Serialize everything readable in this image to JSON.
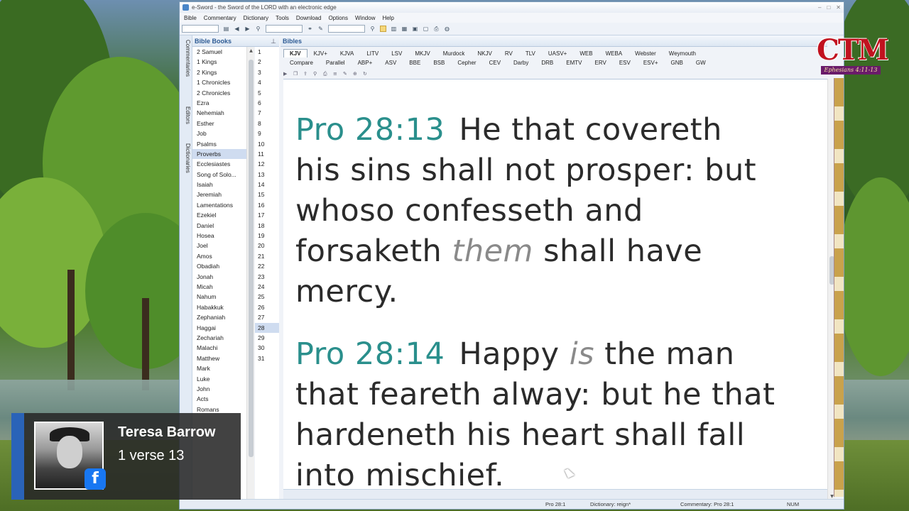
{
  "window": {
    "title": "e-Sword - the Sword of the LORD with an electronic edge",
    "menu": [
      "Bible",
      "Commentary",
      "Dictionary",
      "Tools",
      "Download",
      "Options",
      "Window",
      "Help"
    ]
  },
  "side_tabs": [
    "Commentaries",
    "Editors",
    "Dictionaries"
  ],
  "books_panel": {
    "title": "Bible Books",
    "books": [
      "2 Samuel",
      "1 Kings",
      "2 Kings",
      "1 Chronicles",
      "2 Chronicles",
      "Ezra",
      "Nehemiah",
      "Esther",
      "Job",
      "Psalms",
      "Proverbs",
      "Ecclesiastes",
      "Song of Solo...",
      "Isaiah",
      "Jeremiah",
      "Lamentations",
      "Ezekiel",
      "Daniel",
      "Hosea",
      "Joel",
      "Amos",
      "Obadiah",
      "Jonah",
      "Micah",
      "Nahum",
      "Habakkuk",
      "Zephaniah",
      "Haggai",
      "Zechariah",
      "Malachi",
      "Matthew",
      "Mark",
      "Luke",
      "John",
      "Acts",
      "Romans"
    ],
    "selected_book": "Proverbs",
    "chapters": [
      "1",
      "2",
      "3",
      "4",
      "5",
      "6",
      "7",
      "8",
      "9",
      "10",
      "11",
      "12",
      "13",
      "14",
      "15",
      "16",
      "17",
      "18",
      "19",
      "20",
      "21",
      "22",
      "23",
      "24",
      "25",
      "26",
      "27",
      "28",
      "29",
      "30",
      "31"
    ],
    "selected_chapter": "28"
  },
  "bibles_panel": {
    "title": "Bibles",
    "tabs_row1": [
      "KJV",
      "KJV+",
      "KJVA",
      "LITV",
      "LSV",
      "MKJV",
      "Murdock",
      "NKJV",
      "RV",
      "TLV",
      "UASV+",
      "WEB",
      "WEBA",
      "Webster",
      "Weymouth"
    ],
    "tabs_row2": [
      "Compare",
      "Parallel",
      "ABP+",
      "ASV",
      "BBE",
      "BSB",
      "Cepher",
      "CEV",
      "Darby",
      "DRB",
      "EMTV",
      "ERV",
      "ESV",
      "ESV+",
      "GNB",
      "GW"
    ],
    "active_tab": "KJV",
    "verses": [
      {
        "ref": "Pro 28:13",
        "lines": [
          [
            "He that covereth"
          ],
          [
            "his sins shall not prosper: but"
          ],
          [
            "whoso confesseth and"
          ],
          [
            "forsaketh ",
            {
              "italic": "them"
            },
            " shall have"
          ],
          [
            "mercy."
          ]
        ]
      },
      {
        "ref": "Pro 28:14",
        "lines": [
          [
            "Happy ",
            {
              "italic": "is"
            },
            " the man"
          ],
          [
            "that feareth alway: but he that"
          ],
          [
            "hardeneth his heart shall fall"
          ],
          [
            "into mischief."
          ]
        ]
      }
    ]
  },
  "status_bar": {
    "bible": "Pro 28:1",
    "dictionary": "Dictionary: reign*",
    "commentary": "Commentary: Pro 28:1",
    "num": "NUM"
  },
  "logo": {
    "mark": "CTM",
    "verse": "Ephesians 4:11-13"
  },
  "comment": {
    "name": "Teresa Barrow",
    "message": "1 verse 13",
    "platform_icon": "facebook-icon"
  },
  "colors": {
    "verse_ref": "#2a8f8c",
    "italic_text": "#8a8a8a",
    "panel_header": "#2c5a94",
    "logo_red": "#c1121f",
    "facebook_blue": "#1877f2"
  }
}
